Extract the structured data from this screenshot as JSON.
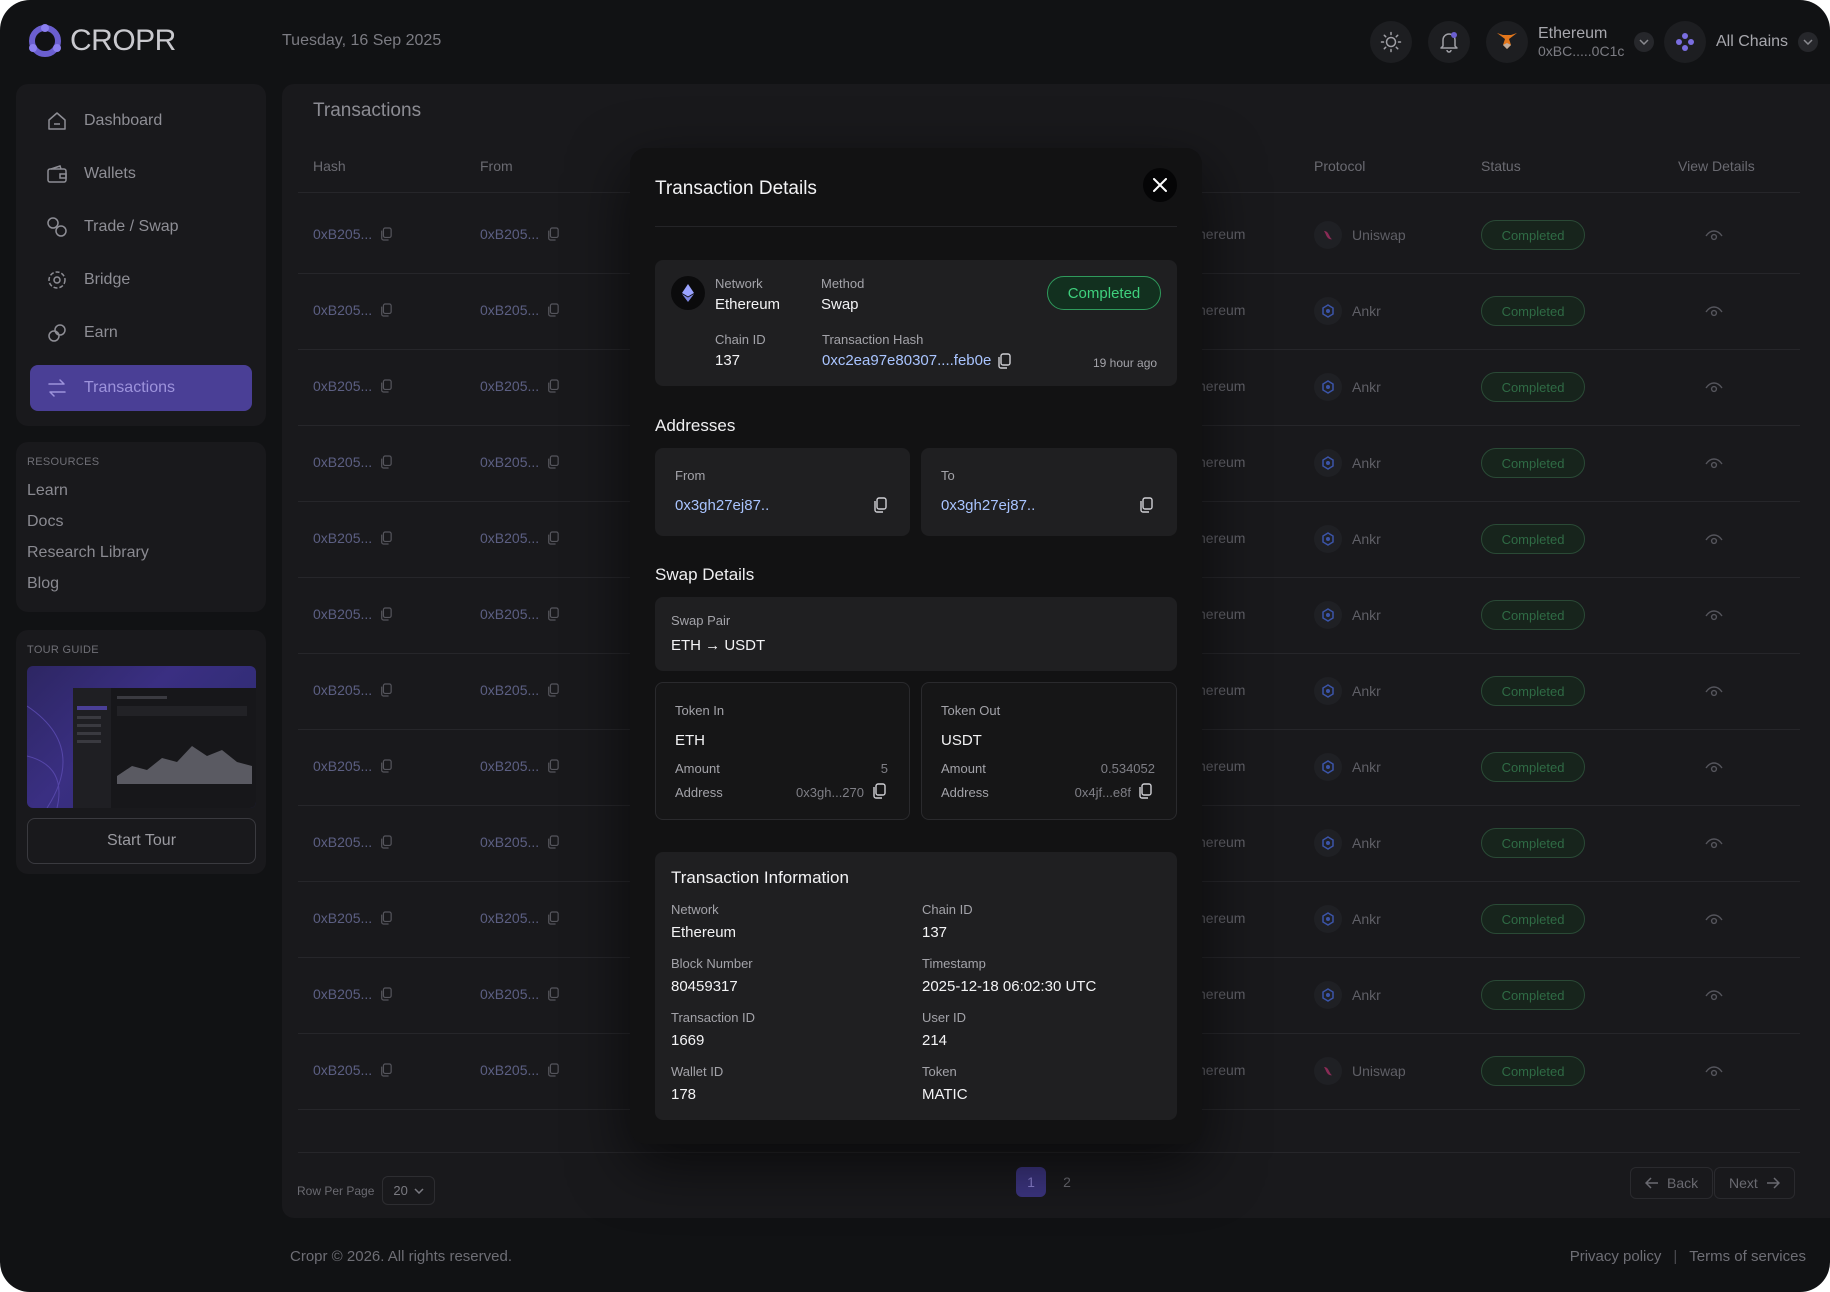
{
  "header": {
    "brand": "CROPR",
    "date": "Tuesday, 16 Sep 2025",
    "wallet": {
      "network": "Ethereum",
      "address": "0xBC.....0C1c"
    },
    "chains_label": "All Chains"
  },
  "sidebar": {
    "nav": [
      {
        "label": "Dashboard",
        "icon": "home-icon"
      },
      {
        "label": "Wallets",
        "icon": "wallet-icon"
      },
      {
        "label": "Trade / Swap",
        "icon": "swap-icon"
      },
      {
        "label": "Bridge",
        "icon": "bridge-icon"
      },
      {
        "label": "Earn",
        "icon": "earn-icon"
      },
      {
        "label": "Transactions",
        "icon": "transactions-icon",
        "active": true
      }
    ],
    "resources": {
      "title": "RESOURCES",
      "links": [
        "Learn",
        "Docs",
        "Research Library",
        "Blog"
      ]
    },
    "tour": {
      "title": "TOUR GUIDE",
      "button": "Start Tour"
    }
  },
  "transactions": {
    "title": "Transactions",
    "columns": [
      "Hash",
      "From",
      "Protocol",
      "Status",
      "View Details"
    ],
    "rows": [
      {
        "hash": "0xB205...",
        "from": "0xB205...",
        "network": "hereum",
        "protocol": "Uniswap",
        "status": "Completed"
      },
      {
        "hash": "0xB205...",
        "from": "0xB205...",
        "network": "hereum",
        "protocol": "Ankr",
        "status": "Completed"
      },
      {
        "hash": "0xB205...",
        "from": "0xB205...",
        "network": "hereum",
        "protocol": "Ankr",
        "status": "Completed"
      },
      {
        "hash": "0xB205...",
        "from": "0xB205...",
        "network": "hereum",
        "protocol": "Ankr",
        "status": "Completed"
      },
      {
        "hash": "0xB205...",
        "from": "0xB205...",
        "network": "hereum",
        "protocol": "Ankr",
        "status": "Completed"
      },
      {
        "hash": "0xB205...",
        "from": "0xB205...",
        "network": "hereum",
        "protocol": "Ankr",
        "status": "Completed"
      },
      {
        "hash": "0xB205...",
        "from": "0xB205...",
        "network": "hereum",
        "protocol": "Ankr",
        "status": "Completed"
      },
      {
        "hash": "0xB205...",
        "from": "0xB205...",
        "network": "hereum",
        "protocol": "Ankr",
        "status": "Completed"
      },
      {
        "hash": "0xB205...",
        "from": "0xB205...",
        "network": "hereum",
        "protocol": "Ankr",
        "status": "Completed"
      },
      {
        "hash": "0xB205...",
        "from": "0xB205...",
        "network": "hereum",
        "protocol": "Ankr",
        "status": "Completed"
      },
      {
        "hash": "0xB205...",
        "from": "0xB205...",
        "network": "hereum",
        "protocol": "Ankr",
        "status": "Completed"
      },
      {
        "hash": "0xB205...",
        "from": "0xB205...",
        "network": "hereum",
        "protocol": "Uniswap",
        "status": "Completed"
      }
    ],
    "pagination": {
      "rows_per_page_label": "Row Per Page",
      "rows_per_page": "20",
      "pages": [
        "1",
        "2"
      ],
      "back": "Back",
      "next": "Next"
    }
  },
  "footer": {
    "copyright": "Cropr © 2026. All rights reserved.",
    "privacy": "Privacy policy",
    "terms": "Terms of services"
  },
  "modal": {
    "title": "Transaction Details",
    "summary": {
      "network_label": "Network",
      "network": "Ethereum",
      "method_label": "Method",
      "method": "Swap",
      "status": "Completed",
      "chain_id_label": "Chain ID",
      "chain_id": "137",
      "tx_hash_label": "Transaction Hash",
      "tx_hash": "0xc2ea97e80307....feb0e",
      "time_ago": "19 hour ago"
    },
    "addresses": {
      "title": "Addresses",
      "from_label": "From",
      "from": "0x3gh27ej87..",
      "to_label": "To",
      "to": "0x3gh27ej87.."
    },
    "swap": {
      "title": "Swap Details",
      "pair_label": "Swap Pair",
      "pair": "ETH → USDT",
      "token_in": {
        "label": "Token In",
        "symbol": "ETH",
        "amount_label": "Amount",
        "amount": "5",
        "address_label": "Address",
        "address": "0x3gh...270"
      },
      "token_out": {
        "label": "Token Out",
        "symbol": "USDT",
        "amount_label": "Amount",
        "amount": "0.534052",
        "address_label": "Address",
        "address": "0x4jf...e8f"
      }
    },
    "info": {
      "title": "Transaction Information",
      "fields": [
        {
          "label": "Network",
          "value": "Ethereum"
        },
        {
          "label": "Chain ID",
          "value": "137"
        },
        {
          "label": "Block Number",
          "value": "80459317"
        },
        {
          "label": "Timestamp",
          "value": "2025-12-18 06:02:30 UTC"
        },
        {
          "label": "Transaction ID",
          "value": "1669"
        },
        {
          "label": "User ID",
          "value": "214"
        },
        {
          "label": "Wallet ID",
          "value": "178"
        },
        {
          "label": "Token",
          "value": "MATIC"
        }
      ]
    }
  },
  "colors": {
    "background": "#111214",
    "panel": "#19191c",
    "accent": "#4a3f96",
    "success": "#3fd07d",
    "link": "#a9c4ff"
  }
}
